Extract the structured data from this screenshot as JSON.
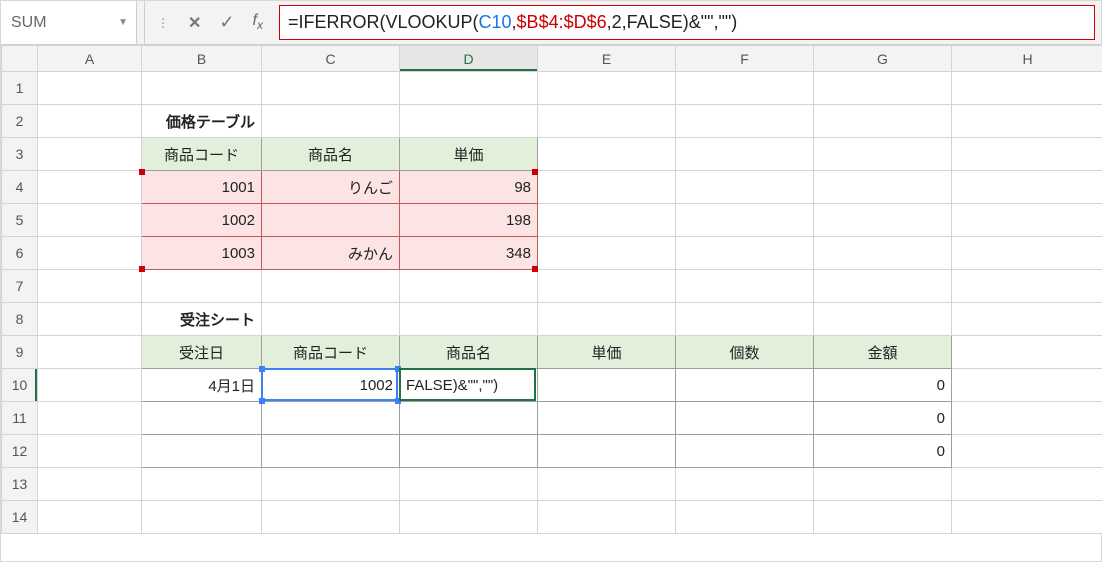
{
  "namebox": {
    "value": "SUM"
  },
  "formula": {
    "raw": "=IFERROR(VLOOKUP(C10,$B$4:$D$6,2,FALSE)&\"\",\"\")",
    "parts": {
      "eq": "=",
      "fn1": "IFERROR",
      "lp1": "(",
      "fn2": "VLOOKUP",
      "lp2": "(",
      "ref_c10": "C10",
      "comma1": ",",
      "ref_range": "$B$4:$D$6",
      "comma2": ",",
      "col": "2",
      "comma3": ",",
      "false": "FALSE",
      "rp2": ")",
      "amp": "&\"\"",
      "comma4": ",",
      "empty": "\"\"",
      "rp1": ")"
    }
  },
  "columns": [
    "A",
    "B",
    "C",
    "D",
    "E",
    "F",
    "G",
    "H"
  ],
  "rows": [
    "1",
    "2",
    "3",
    "4",
    "5",
    "6",
    "7",
    "8",
    "9",
    "10",
    "11",
    "12",
    "13",
    "14"
  ],
  "labels": {
    "price_table_title": "価格テーブル",
    "order_sheet_title": "受注シート",
    "price_headers": {
      "code": "商品コード",
      "name": "商品名",
      "unit": "単価"
    },
    "order_headers": {
      "date": "受注日",
      "code": "商品コード",
      "name": "商品名",
      "unit": "単価",
      "qty": "個数",
      "amount": "金額"
    }
  },
  "price_table": [
    {
      "code": "1001",
      "name": "りんご",
      "unit": "98"
    },
    {
      "code": "1002",
      "name": "",
      "unit": "198"
    },
    {
      "code": "1003",
      "name": "みかん",
      "unit": "348"
    }
  ],
  "order_rows": [
    {
      "date": "4月1日",
      "code": "1002",
      "name_cell": "FALSE)&\"\",\"\")",
      "unit": "",
      "qty": "",
      "amount": "0"
    },
    {
      "date": "",
      "code": "",
      "name_cell": "",
      "unit": "",
      "qty": "",
      "amount": "0"
    },
    {
      "date": "",
      "code": "",
      "name_cell": "",
      "unit": "",
      "qty": "",
      "amount": "0"
    }
  ],
  "active_cell": "D10",
  "chart_data": {
    "type": "table",
    "tables": [
      {
        "title": "価格テーブル",
        "columns": [
          "商品コード",
          "商品名",
          "単価"
        ],
        "rows": [
          [
            "1001",
            "りんご",
            98
          ],
          [
            "1002",
            "",
            198
          ],
          [
            "1003",
            "みかん",
            348
          ]
        ]
      },
      {
        "title": "受注シート",
        "columns": [
          "受注日",
          "商品コード",
          "商品名",
          "単価",
          "個数",
          "金額"
        ],
        "rows": [
          [
            "4月1日",
            1002,
            "FALSE)&\"\",\"\")",
            "",
            "",
            0
          ],
          [
            "",
            "",
            "",
            "",
            "",
            0
          ],
          [
            "",
            "",
            "",
            "",
            "",
            0
          ]
        ]
      }
    ]
  }
}
